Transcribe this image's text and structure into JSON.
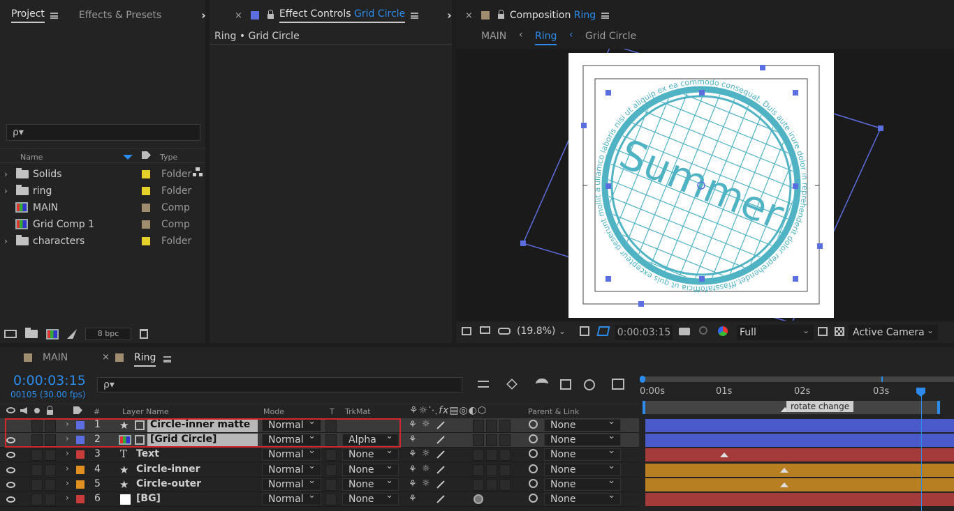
{
  "project": {
    "tab": "Project",
    "tab2": "Effects & Presets",
    "search_placeholder": "ρ▾",
    "col_name": "Name",
    "col_type": "Type",
    "bpc": "8 bpc",
    "items": [
      {
        "name": "Solids",
        "type": "Folder",
        "icon": "folder-icon",
        "color": "#e6d12a",
        "expand": true
      },
      {
        "name": "ring",
        "type": "Folder",
        "icon": "folder-icon",
        "color": "#e6d12a",
        "expand": true
      },
      {
        "name": "MAIN",
        "type": "Comp",
        "icon": "composition-icon",
        "color": "#a08c6e",
        "expand": false
      },
      {
        "name": "Grid Comp 1",
        "type": "Comp",
        "icon": "composition-icon",
        "color": "#a08c6e",
        "expand": false
      },
      {
        "name": "characters",
        "type": "Folder",
        "icon": "folder-icon",
        "color": "#e6d12a",
        "expand": true
      }
    ]
  },
  "effect": {
    "tab_prefix": "Effect Controls",
    "tab_target": "Grid Circle",
    "breadcrumb": "Ring • Grid Circle",
    "color": "#5d6ee0"
  },
  "comp": {
    "tab_prefix": "Composition",
    "tab_target": "Ring",
    "color": "#a08c6e",
    "nav": [
      "MAIN",
      "Ring",
      "Grid Circle"
    ],
    "canvas_text": "Summer",
    "ring_text": "ullamco laboris nisi ut aliquip ex ea commodo consequat. Duis aute irure dolor in reprehenderit dolor reprehendet.fffassfafofficia ut quis excepteur deserunt mollit anim id est laborum sint occaecat cupidatat non proident, sunt in culpa qui officia deserunt mollit",
    "zoom": "(19.8%)",
    "timecode": "0:00:03:15",
    "resolution": "Full",
    "camera": "Active Camera"
  },
  "timeline": {
    "tabs": [
      "MAIN",
      "Ring"
    ],
    "active_tab": "Ring",
    "tab_colors": [
      "#a08c6e",
      "#a08c6e"
    ],
    "timecode": "0:00:03:15",
    "frames": "00105 (30.00 fps)",
    "search_placeholder": "ρ▾",
    "headers": {
      "num": "#",
      "layer_name": "Layer Name",
      "mode": "Mode",
      "t": "T",
      "trkmat": "TrkMat",
      "parent": "Parent & Link"
    },
    "ruler": [
      "0:00s",
      "01s",
      "02s",
      "03s"
    ],
    "marker": "rotate change",
    "layers": [
      {
        "num": "1",
        "name": "Circle-inner matte",
        "type": "shape",
        "color": "#5d6ee0",
        "mode": "Normal",
        "trkmat": "",
        "parent": "None",
        "bar": "#4a5ac8",
        "visible": false,
        "selected": true
      },
      {
        "num": "2",
        "name": "[Grid Circle]",
        "type": "comp",
        "color": "#5d6ee0",
        "mode": "Normal",
        "trkmat": "Alpha",
        "parent": "None",
        "bar": "#4a5ac8",
        "visible": true,
        "selected": true
      },
      {
        "num": "3",
        "name": "Text",
        "type": "text",
        "color": "#c83c3c",
        "mode": "Normal",
        "trkmat": "None",
        "parent": "None",
        "bar": "#a33b3b",
        "visible": true,
        "selected": false
      },
      {
        "num": "4",
        "name": "Circle-inner",
        "type": "shape",
        "color": "#e09020",
        "mode": "Normal",
        "trkmat": "None",
        "parent": "None",
        "bar": "#b87f22",
        "visible": true,
        "selected": false
      },
      {
        "num": "5",
        "name": "Circle-outer",
        "type": "shape",
        "color": "#e09020",
        "mode": "Normal",
        "trkmat": "None",
        "parent": "None",
        "bar": "#b87f22",
        "visible": true,
        "selected": false
      },
      {
        "num": "6",
        "name": "[BG]",
        "type": "solid",
        "color": "#c83c3c",
        "mode": "Normal",
        "trkmat": "None",
        "parent": "None",
        "bar": "#a33b3b",
        "visible": true,
        "selected": false
      }
    ]
  }
}
